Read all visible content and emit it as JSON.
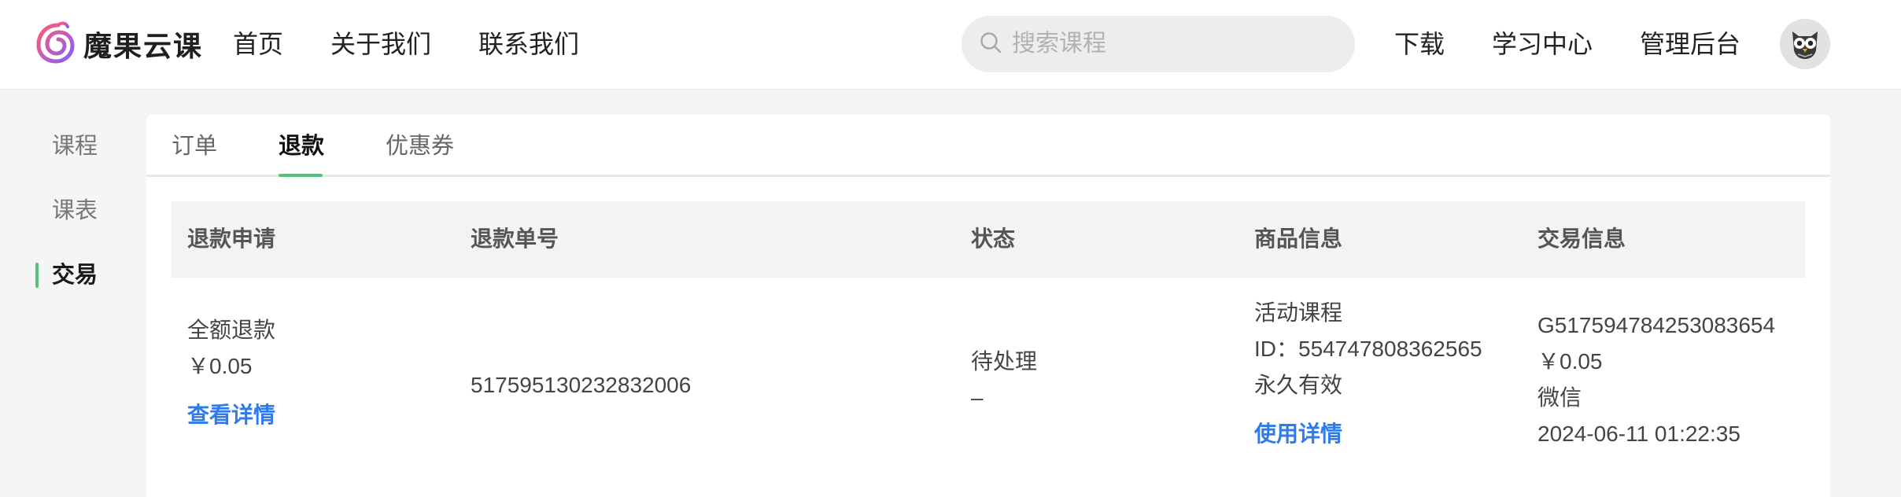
{
  "header": {
    "brand": "魔果云课",
    "nav": [
      "首页",
      "关于我们",
      "联系我们"
    ],
    "search_placeholder": "搜索课程",
    "right_nav": [
      "下载",
      "学习中心",
      "管理后台"
    ],
    "icons": {
      "logo": "spiral-logo-icon",
      "search": "search-icon",
      "avatar": "owl-avatar-icon"
    }
  },
  "sidebar": {
    "items": [
      "课程",
      "课表",
      "交易"
    ],
    "active": "交易"
  },
  "tabs": {
    "items": [
      "订单",
      "退款",
      "优惠券"
    ],
    "active": "退款"
  },
  "table": {
    "columns": [
      "退款申请",
      "退款单号",
      "状态",
      "商品信息",
      "交易信息"
    ],
    "rows": [
      {
        "apply_type": "全额退款",
        "apply_amount": "￥0.05",
        "apply_link": "查看详情",
        "refund_no": "517595130232832006",
        "status": "待处理",
        "status_sub": "–",
        "product_name": "活动课程",
        "product_id": "ID：554747808362565",
        "product_validity": "永久有效",
        "product_link": "使用详情",
        "trade_no": "G517594784253083654",
        "trade_amount": "￥0.05",
        "trade_channel": "微信",
        "trade_time": "2024-06-11 01:22:35"
      }
    ]
  },
  "colors": {
    "accent_green": "#4cc779",
    "link_blue": "#2f7bea",
    "logo_gradient": [
      "#ff5c6e",
      "#8a5cff"
    ]
  }
}
